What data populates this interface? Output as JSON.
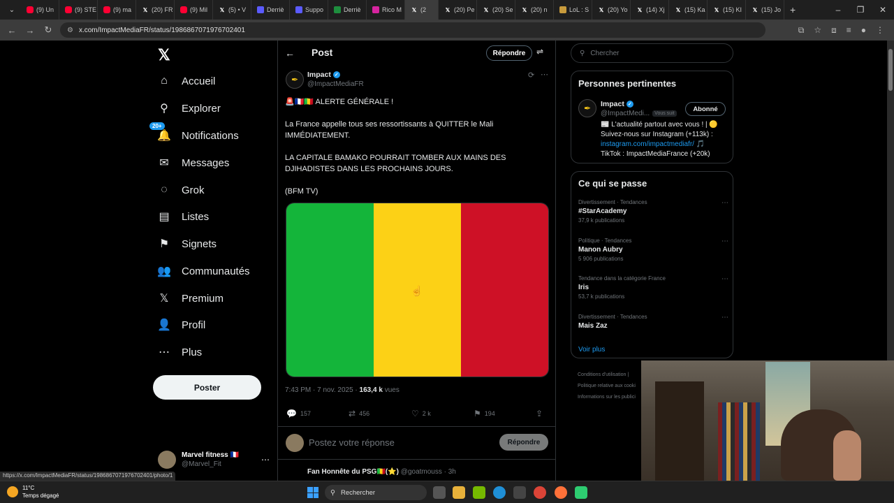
{
  "browser": {
    "tabs": [
      {
        "label": "(9) Un",
        "icon": "youtube-icon",
        "color": "yt"
      },
      {
        "label": "(9) STE",
        "icon": "youtube-icon",
        "color": "yt"
      },
      {
        "label": "(9) ma",
        "icon": "youtube-icon",
        "color": "yt"
      },
      {
        "label": "(20) FR",
        "icon": "x-icon",
        "color": "x"
      },
      {
        "label": "(9) Mil",
        "icon": "youtube-icon",
        "color": "yt"
      },
      {
        "label": "(5) • V",
        "icon": "x-icon",
        "color": "x"
      },
      {
        "label": "Derriè",
        "icon": "page-icon",
        "color": "blue"
      },
      {
        "label": "Suppo",
        "icon": "page-icon",
        "color": "blue"
      },
      {
        "label": "Derriè",
        "icon": "page-icon",
        "color": "green"
      },
      {
        "label": "Rico M",
        "icon": "instagram-icon",
        "color": "insta"
      },
      {
        "label": "(2",
        "icon": "x-icon",
        "color": "x",
        "active": true
      },
      {
        "label": "(20) Pe",
        "icon": "x-icon",
        "color": "x"
      },
      {
        "label": "(20) Se",
        "icon": "x-icon",
        "color": "x"
      },
      {
        "label": "(20) n",
        "icon": "x-icon",
        "color": "x"
      },
      {
        "label": "LoL : S",
        "icon": "lol-icon",
        "color": "lol"
      },
      {
        "label": "(20) Yo",
        "icon": "x-icon",
        "color": "x"
      },
      {
        "label": "(14) Xj",
        "icon": "x-icon",
        "color": "x"
      },
      {
        "label": "(15) Ka",
        "icon": "x-icon",
        "color": "x"
      },
      {
        "label": "(15) KI",
        "icon": "x-icon",
        "color": "x"
      },
      {
        "label": "(15) Jo",
        "icon": "x-icon",
        "color": "x"
      }
    ],
    "url": "x.com/ImpactMediaFR/status/1986867071976702401",
    "status_url": "https://x.com/ImpactMediaFR/status/1986867071976702401/photo/1"
  },
  "sidebar": {
    "logo": "𝕏",
    "items": [
      {
        "label": "Accueil",
        "icon": "home-icon",
        "glyph": "⌂"
      },
      {
        "label": "Explorer",
        "icon": "search-icon",
        "glyph": "⚲"
      },
      {
        "label": "Notifications",
        "icon": "bell-icon",
        "glyph": "🔔",
        "badge": "20+"
      },
      {
        "label": "Messages",
        "icon": "mail-icon",
        "glyph": "✉"
      },
      {
        "label": "Grok",
        "icon": "grok-icon",
        "glyph": "◌"
      },
      {
        "label": "Listes",
        "icon": "list-icon",
        "glyph": "▤"
      },
      {
        "label": "Signets",
        "icon": "bookmark-icon",
        "glyph": "⚑"
      },
      {
        "label": "Communautés",
        "icon": "communities-icon",
        "glyph": "👥"
      },
      {
        "label": "Premium",
        "icon": "x-premium-icon",
        "glyph": "𝕏"
      },
      {
        "label": "Profil",
        "icon": "profile-icon",
        "glyph": "👤"
      },
      {
        "label": "Plus",
        "icon": "more-circle-icon",
        "glyph": "⋯"
      }
    ],
    "post_button": "Poster",
    "account": {
      "name": "Marvel fitness 🇫🇷",
      "handle": "@Marvel_Fit"
    }
  },
  "post": {
    "header_title": "Post",
    "reply_button": "Répondre",
    "author": {
      "name": "Impact",
      "handle": "@ImpactMediaFR"
    },
    "text_lines": [
      "🚨🇫🇷🇲🇱 ALERTE GÉNÉRALE !",
      "La France appelle tous ses ressortissants à QUITTER le Mali IMMÉDIATEMENT.",
      "LA CAPITALE BAMAKO POURRAIT TOMBER AUX MAINS DES DJIHADISTES DANS LES PROCHAINS JOURS.",
      "(BFM TV)"
    ],
    "flag_colors": [
      "#14b53a",
      "#fcd116",
      "#ce1126"
    ],
    "time": "7:43 PM · 7 nov. 2025 · ",
    "views": "163,4 k",
    "views_label": " vues",
    "stats": {
      "replies": "157",
      "reposts": "456",
      "likes": "2 k",
      "bookmarks": "194"
    },
    "reply_placeholder": "Postez votre réponse",
    "reply_submit": "Répondre",
    "next_reply": {
      "name": "Fan Honnête du PSG🇲🇱(⭐)",
      "meta": " @goatmouss · 3h"
    }
  },
  "right": {
    "search_placeholder": "Chercher",
    "relevant_title": "Personnes pertinentes",
    "relevant": {
      "name": "Impact",
      "handle": "@ImpactMedi...",
      "follows_you": "Vous suit",
      "follow_state": "Abonné",
      "bio_1": "📰 L'actualité partout avec vous ! | 🟡 Suivez-nous sur Instagram (+113k) : ",
      "bio_link": "instagram.com/impactmediafr/",
      "bio_2": " 🎵 TikTok : ImpactMediaFrance (+20k)"
    },
    "trends_title": "Ce qui se passe",
    "trends": [
      {
        "category": "Divertissement · Tendances",
        "name": "#StarAcademy",
        "count": "37,9 k publications"
      },
      {
        "category": "Politique · Tendances",
        "name": "Manon Aubry",
        "count": "5 906 publications"
      },
      {
        "category": "Tendance dans la catégorie France",
        "name": "Iris",
        "count": "53,7 k publications"
      },
      {
        "category": "Divertissement · Tendances",
        "name": "Mais Zaz",
        "count": ""
      }
    ],
    "show_more": "Voir plus",
    "footer": [
      "Conditions d'utilisation |",
      "Politique relative aux cooki",
      "Informations sur les publici"
    ]
  },
  "taskbar": {
    "temp": "11°C",
    "weather": "Temps dégagé",
    "search": "Rechercher"
  }
}
